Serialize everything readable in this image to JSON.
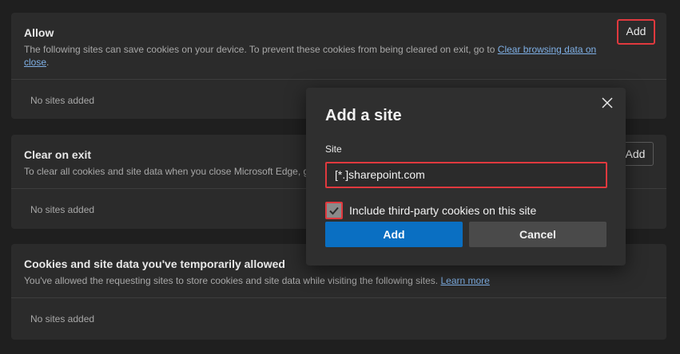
{
  "allow_section": {
    "title": "Allow",
    "desc_text": "The following sites can save cookies on your device. To prevent these cookies from being cleared on exit, go to ",
    "desc_link": "Clear browsing data on close",
    "desc_end": ".",
    "add_label": "Add",
    "empty_text": "No sites added"
  },
  "clear_section": {
    "title": "Clear on exit",
    "desc_text": "To clear all cookies and site data when you close Microsoft Edge, go",
    "add_label": "Add",
    "empty_text": "No sites added"
  },
  "temp_section": {
    "title": "Cookies and site data you've temporarily allowed",
    "desc_text": "You've allowed the requesting sites to store cookies and site data while visiting the following sites. ",
    "desc_link": "Learn more",
    "empty_text": "No sites added"
  },
  "dialog": {
    "title": "Add a site",
    "close_icon": "close-icon",
    "site_label": "Site",
    "site_value": "[*.]sharepoint.com",
    "checkbox_checked": true,
    "checkbox_label": "Include third-party cookies on this site",
    "add_button": "Add",
    "cancel_button": "Cancel"
  },
  "colors": {
    "highlight": "#e0393e",
    "primary": "#0a6fc2",
    "link": "#7fb0e6"
  }
}
